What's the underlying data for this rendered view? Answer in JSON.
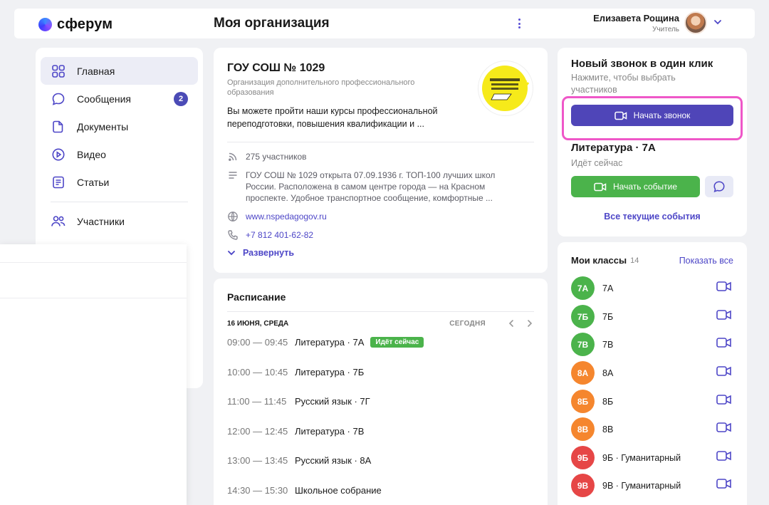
{
  "header": {
    "logo_text": "сферум",
    "page_title": "Моя организация",
    "user_name": "Елизавета Рощина",
    "user_role": "Учитель"
  },
  "sidebar": {
    "items": [
      {
        "label": "Главная",
        "icon": "home-grid-icon"
      },
      {
        "label": "Сообщения",
        "icon": "chat-bubble-icon",
        "badge": "2"
      },
      {
        "label": "Документы",
        "icon": "document-icon"
      },
      {
        "label": "Видео",
        "icon": "play-circle-icon"
      },
      {
        "label": "Статьи",
        "icon": "article-icon"
      },
      {
        "label": "Участники",
        "icon": "people-icon"
      }
    ]
  },
  "org": {
    "title": "ГОУ СОШ № 1029",
    "subtitle": "Организация дополнительного профессионального образования",
    "description": "Вы можете пройти наши курсы профессиональной переподготовки, повышения квалификации и ...",
    "participants": "275 участников",
    "about": "ГОУ СОШ № 1029 открыта 07.09.1936 г. ТОП-100 лучших школ России. Расположена в самом центре города — на Красном проспекте. Удобное транспортное сообщение, комфортные ...",
    "website": "www.nspedagogov.ru",
    "phone": "+7 812 401-62-82",
    "expand_label": "Развернуть"
  },
  "schedule": {
    "title": "Расписание",
    "date": "16 ИЮНЯ, СРЕДА",
    "today_label": "СЕГОДНЯ",
    "lessons": [
      {
        "time": "09:00 — 09:45",
        "name": "Литература · 7А",
        "badge": "Идёт сейчас"
      },
      {
        "time": "10:00 — 10:45",
        "name": "Литература · 7Б"
      },
      {
        "time": "11:00 — 11:45",
        "name": "Русский язык · 7Г"
      },
      {
        "time": "12:00 — 12:45",
        "name": "Литература · 7В"
      },
      {
        "time": "13:00 — 13:45",
        "name": "Русский язык · 8А"
      },
      {
        "time": "14:30 — 15:30",
        "name": "Школьное собрание"
      }
    ]
  },
  "call": {
    "title": "Новый звонок в один клик",
    "subtitle": "Нажмите, чтобы выбрать участников",
    "button_label": "Начать звонок",
    "event_title": "Литература · 7А",
    "event_status": "Идёт сейчас",
    "event_button_label": "Начать событие",
    "events_link": "Все текущие события",
    "highlight_color": "#ef57c8"
  },
  "classes": {
    "title": "Мои классы",
    "count": "14",
    "show_all": "Показать все",
    "items": [
      {
        "avatar": "7А",
        "name": "7А",
        "color": "#4bb34b"
      },
      {
        "avatar": "7Б",
        "name": "7Б",
        "color": "#4bb34b"
      },
      {
        "avatar": "7В",
        "name": "7В",
        "color": "#4bb34b"
      },
      {
        "avatar": "8А",
        "name": "8А",
        "color": "#f5862e"
      },
      {
        "avatar": "8Б",
        "name": "8Б",
        "color": "#f5862e"
      },
      {
        "avatar": "8В",
        "name": "8В",
        "color": "#f5862e"
      },
      {
        "avatar": "9Б",
        "name": "9Б · Гуманитарный",
        "color": "#e64646"
      },
      {
        "avatar": "9В",
        "name": "9В · Гуманитарный",
        "color": "#e64646"
      }
    ]
  },
  "colors": {
    "accent": "#4f45b8",
    "green": "#4bb34b",
    "orange": "#f5862e",
    "red": "#e64646"
  }
}
